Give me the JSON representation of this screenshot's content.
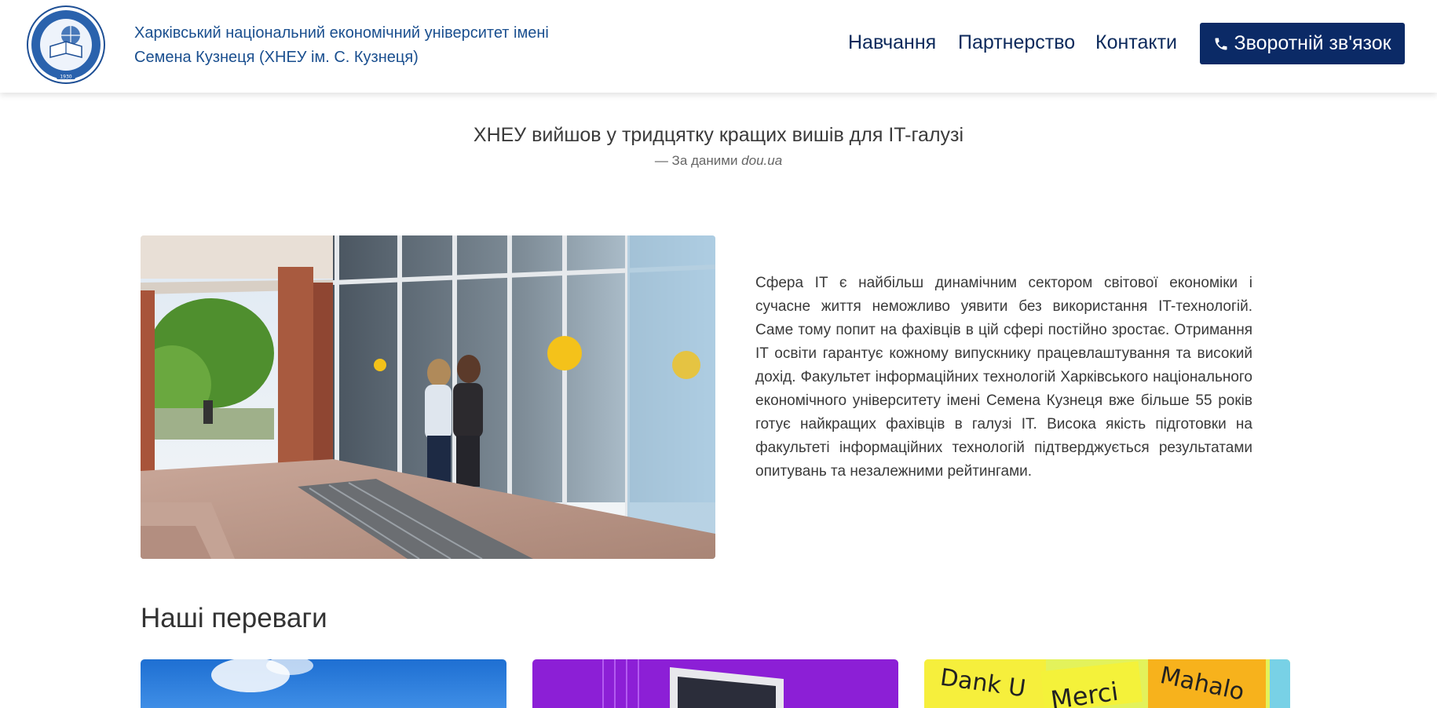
{
  "header": {
    "brand_line1": "Харківський національний економічний університет імені",
    "brand_line2": "Семена Кузнеця (ХНЕУ ім. С. Кузнеця)",
    "logo_icon": "university-seal-icon",
    "logo_year": "1930",
    "nav": [
      {
        "label": "Навчання"
      },
      {
        "label": "Партнерство"
      },
      {
        "label": "Контакти"
      }
    ],
    "cta_label": "Зворотній зв'язок",
    "cta_icon": "phone-icon"
  },
  "quote": {
    "title": "ХНЕУ вийшов у тридцятку кращих вишів для IT-галузі",
    "source_prefix": "—  За даними ",
    "source_name": "dou.ua"
  },
  "intro": {
    "text": "Сфера IT є найбільш динамічним сектором світової економіки і сучасне життя неможливо уявити без використання IT-технологій. Саме тому попит на фахівців в цій сфері постійно зростає. Отримання IT освіти гарантує кожному випускнику працевлаштування та високий дохід. Факультет інформаційних технологій Харківського національного економічного університету імені Семена Кузнеця вже більше 55 років готує найкращих фахівців в галузі IT. Висока якість підготовки на факультеті інформаційних технологій підтверджується результатами опитувань та незалежними рейтингами."
  },
  "advantages": {
    "title": "Наші переваги",
    "cards": [
      {
        "image": "sky-photo"
      },
      {
        "image": "computer-photo"
      },
      {
        "image": "thank-you-notes-photo",
        "words": [
          "Dank U",
          "Merci",
          "Mahalo"
        ]
      }
    ]
  },
  "colors": {
    "brand_blue": "#1a4f8f",
    "nav_text": "#0d2a5c",
    "cta_bg": "#0b2a66"
  }
}
